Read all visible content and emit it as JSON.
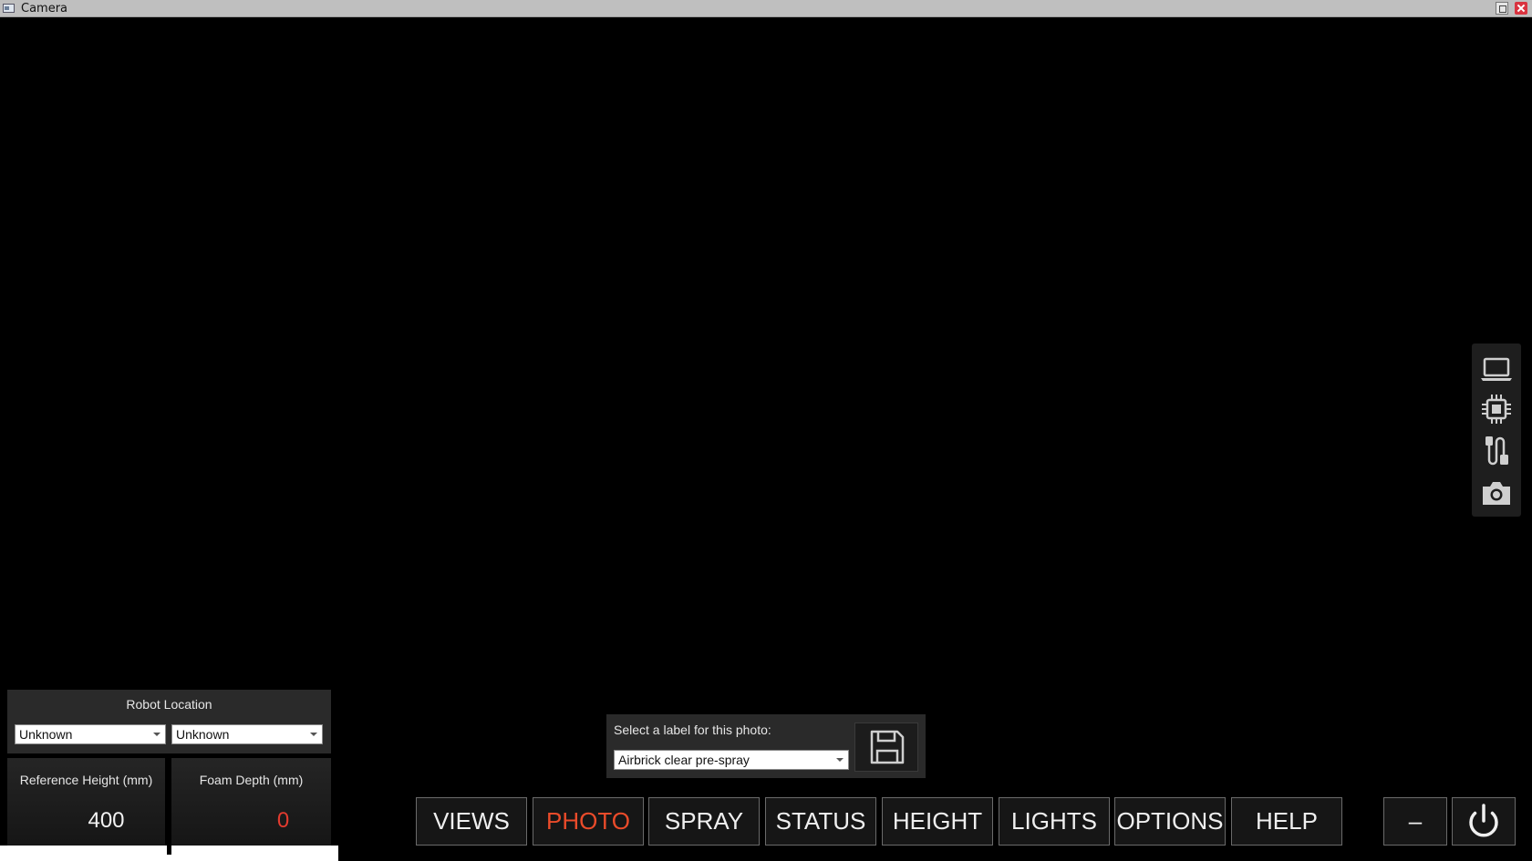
{
  "window": {
    "title": "Camera"
  },
  "robot_location": {
    "header": "Robot Location",
    "primary_value": "Unknown",
    "secondary_value": "Unknown"
  },
  "reference_height": {
    "label": "Reference Height (mm)",
    "value": "400"
  },
  "foam_depth": {
    "label": "Foam Depth (mm)",
    "value": "0",
    "value_color": "#e23b2f"
  },
  "photo_label": {
    "prompt": "Select a label for this photo:",
    "selected": "Airbrick clear pre-spray"
  },
  "nav": {
    "views": "VIEWS",
    "photo": "PHOTO",
    "spray": "SPRAY",
    "status": "STATUS",
    "height": "HEIGHT",
    "lights": "LIGHTS",
    "options": "OPTIONS",
    "help": "HELP",
    "minimize": "–",
    "active_tab": "PHOTO",
    "active_color": "#ea4b2a"
  },
  "side_toolbar": {
    "icons": [
      "laptop-icon",
      "chip-icon",
      "cable-icon",
      "camera-icon"
    ]
  }
}
